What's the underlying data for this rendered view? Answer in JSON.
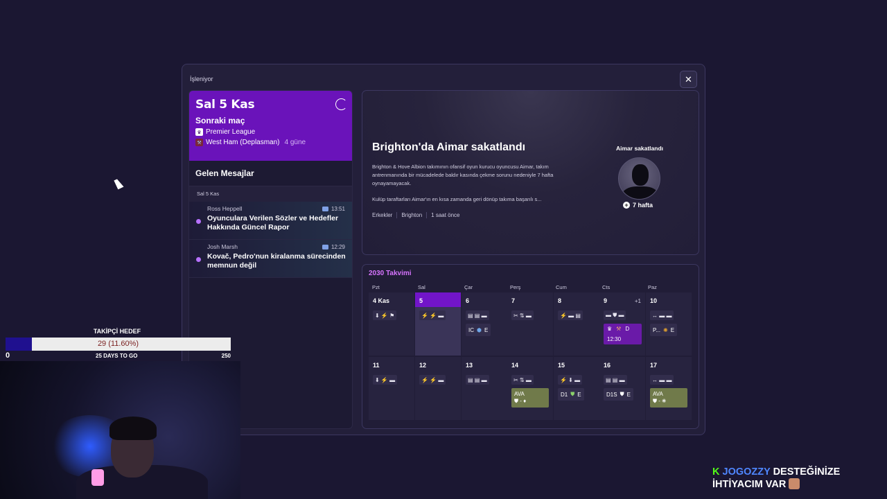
{
  "modal": {
    "title": "İşleniyor",
    "close_label": "✕"
  },
  "next_match": {
    "date": "Sal 5 Kas",
    "label": "Sonraki maç",
    "competition": "Premier League",
    "opponent": "West Ham (Deplasman)",
    "countdown": "4 güne"
  },
  "messages": {
    "heading": "Gelen Mesajlar",
    "date": "Sal 5 Kas",
    "items": [
      {
        "sender": "Ross Heppell",
        "time": "13:51",
        "subject": "Oyunculara Verilen Sözler ve Hedefler Hakkında Güncel Rapor"
      },
      {
        "sender": "Josh Marsh",
        "time": "12:29",
        "subject": "Kovač, Pedro'nun kiralanma sürecinden memnun değil"
      }
    ]
  },
  "news": {
    "title": "Brighton'da Aimar sakatlandı",
    "body": "Brighton & Hove Albion takımının ofansif oyun kurucu oyuncusu Aimar, takım antrenmanında bir mücadelede baldır kasında çekme sorunu nedeniyle 7 hafta oynayamayacak.",
    "body2": "Kulüp taraftarları Aimar'ın en kısa zamanda geri dönüp takıma başarılı s...",
    "tags": [
      "Erkekler",
      "Brighton",
      "1 saat önce"
    ],
    "injury_title": "Aimar sakatlandı",
    "injury_weeks": "7 hafta"
  },
  "calendar": {
    "title": "2030 Takvimi",
    "days": [
      "Pzt",
      "Sal",
      "Çar",
      "Perş",
      "Cum",
      "Cts",
      "Paz"
    ],
    "week1": [
      "4 Kas",
      "5",
      "6",
      "7",
      "8",
      "9",
      "10"
    ],
    "week2": [
      "11",
      "12",
      "13",
      "14",
      "15",
      "16",
      "17"
    ],
    "extra": "+1",
    "ev": {
      "w1_wed": [
        "IC",
        "E"
      ],
      "w1_sat_a": "D",
      "w1_sat_time": "12:30",
      "w1_sun": [
        "P...",
        "E"
      ],
      "w2_sun_a": "AVA",
      "w2_thu": [
        "D1",
        "E"
      ],
      "w2_fri": [
        "D1S",
        "E"
      ],
      "w2_mon_a": "AVA"
    }
  },
  "overlay": {
    "takipci_label": "TAKİPÇİ HEDEF",
    "value": "29 (11.60%)",
    "progress": 0.116,
    "min": "0",
    "max": "250",
    "days": "25 DAYS TO GO"
  },
  "promo": {
    "k": "K",
    "name": "JOGOZZY",
    "line1_rest": "DESTEĞİNİZE",
    "line2": "İHTİYACIM VAR"
  }
}
